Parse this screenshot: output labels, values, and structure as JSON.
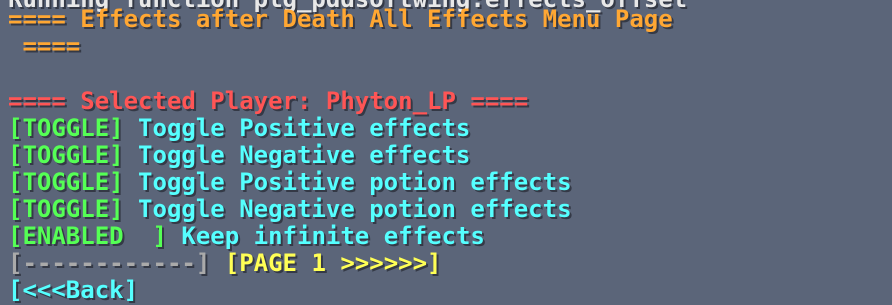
{
  "chat": {
    "cutoff_line": "Running function plg_pddsoftwing:effects_offset",
    "title_line1": "==== Effects after Death All Effects Menu Page",
    "title_line2": " ====",
    "selected_player": "==== Selected Player: Phyton_LP ====",
    "options": [
      {
        "tag": "[TOGGLE]",
        "label": " Toggle Positive effects"
      },
      {
        "tag": "[TOGGLE]",
        "label": " Toggle Negative effects"
      },
      {
        "tag": "[TOGGLE]",
        "label": " Toggle Positive potion effects"
      },
      {
        "tag": "[TOGGLE]",
        "label": " Toggle Negative potion effects"
      },
      {
        "tag": "[ENABLED  ]",
        "label": " Keep infinite effects"
      }
    ],
    "pager": {
      "prev": "[------------]",
      "next": " [PAGE 1 >>>>>>]"
    },
    "back": "[<<<Back]"
  },
  "colors": {
    "background": "#5b6579",
    "title": "#ffa733",
    "selected": "#ff5555",
    "tag": "#55ff55",
    "label": "#55ffff",
    "pager_prev": "#aaaaaa",
    "pager_next": "#ffff55"
  }
}
